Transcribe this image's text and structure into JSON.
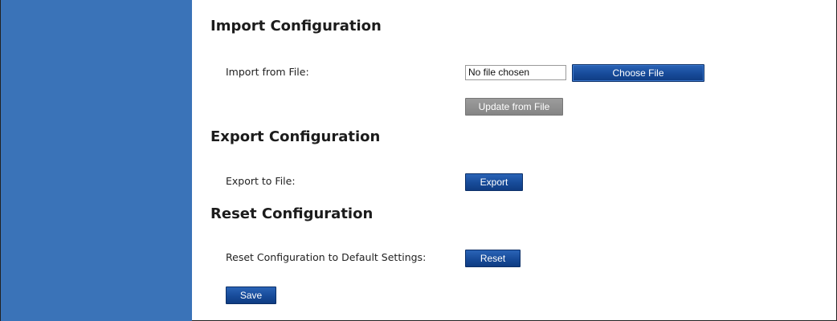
{
  "import": {
    "title": "Import Configuration",
    "file_label": "Import from File:",
    "file_status": "No file chosen",
    "choose_file_label": "Choose File",
    "update_label": "Update from File"
  },
  "export": {
    "title": "Export Configuration",
    "label": "Export to File:",
    "button_label": "Export"
  },
  "reset": {
    "title": "Reset Configuration",
    "label": "Reset Configuration to Default Settings:",
    "button_label": "Reset"
  },
  "save_label": "Save",
  "colors": {
    "sidebar": "#3a73b8",
    "primary_button": "#174b99",
    "disabled_button": "#8e8e8e"
  }
}
